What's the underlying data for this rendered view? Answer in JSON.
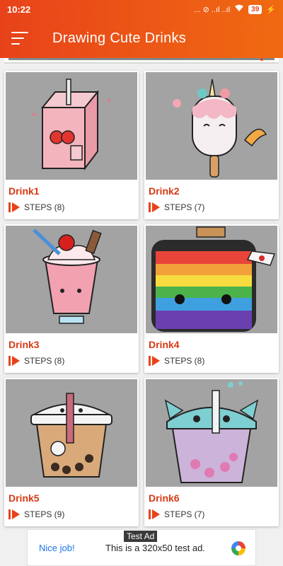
{
  "status_bar": {
    "time": "10:22",
    "indicators": "... ⊘ ..ıl ..ıl",
    "battery": "39"
  },
  "app_bar": {
    "title": "Drawing Cute Drinks",
    "menu_icon": "hamburger-menu-icon"
  },
  "drinks": [
    {
      "name": "Drink1",
      "steps": "STEPS (8)"
    },
    {
      "name": "Drink2",
      "steps": "STEPS (7)"
    },
    {
      "name": "Drink3",
      "steps": "STEPS (8)"
    },
    {
      "name": "Drink4",
      "steps": "STEPS (8)"
    },
    {
      "name": "Drink5",
      "steps": "STEPS (9)"
    },
    {
      "name": "Drink6",
      "steps": "STEPS (7)"
    }
  ],
  "ad": {
    "label": "Test Ad",
    "headline": "Nice job!",
    "message": "This is a 320x50 test ad."
  },
  "colors": {
    "accent": "#e8421a",
    "drink_name": "#d63a14"
  }
}
